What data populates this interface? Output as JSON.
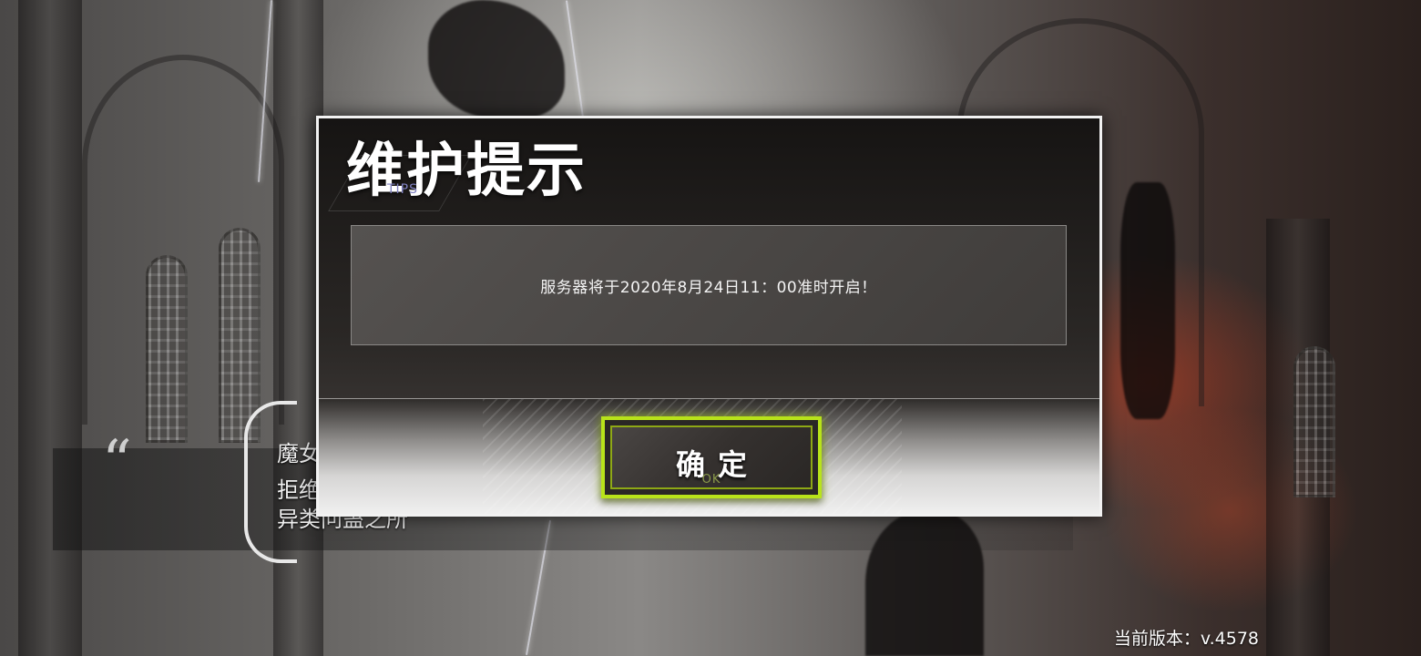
{
  "background_quote": {
    "mark": "“",
    "line1": "魔女",
    "line2": "拒绝",
    "line3": "异类问蛊之所"
  },
  "dialog": {
    "title": "维护提示",
    "subtitle": "TIPS",
    "message": "服务器将于2020年8月24日11：00准时开启！",
    "confirm_label": "确定",
    "confirm_sublabel": "OK"
  },
  "footer": {
    "version_label": "当前版本：",
    "version_value": "v.4578"
  },
  "colors": {
    "accent_green": "#b8e31a",
    "dialog_border": "#f2f2f2",
    "subtitle_color": "#7f80c0"
  },
  "icons": {
    "quote": "open-quote-icon"
  }
}
